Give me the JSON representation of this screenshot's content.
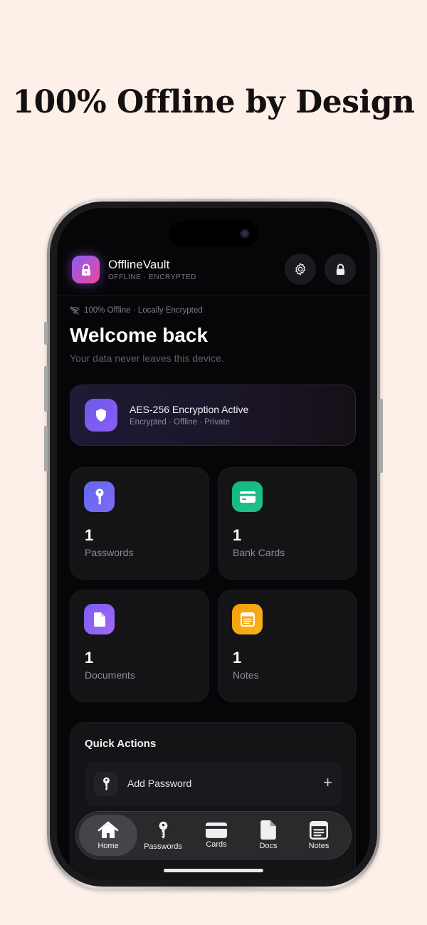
{
  "headline": "100% Offline by Design",
  "app": {
    "name": "OfflineVault",
    "subtitle": "OFFLINE · ENCRYPTED"
  },
  "status": {
    "text": "100% Offline · Locally Encrypted"
  },
  "welcome": {
    "title": "Welcome back",
    "subtitle": "Your data never leaves this device."
  },
  "encryption": {
    "title": "AES-256 Encryption Active",
    "subtitle": "Encrypted · Offline · Private"
  },
  "stats": [
    {
      "count": "1",
      "label": "Passwords",
      "icon": "key-icon",
      "color": "#6366f1"
    },
    {
      "count": "1",
      "label": "Bank Cards",
      "icon": "card-icon",
      "color": "#10b981"
    },
    {
      "count": "1",
      "label": "Documents",
      "icon": "document-icon",
      "color": "#8b5cf6"
    },
    {
      "count": "1",
      "label": "Notes",
      "icon": "note-icon",
      "color": "#f59e0b"
    }
  ],
  "quick_actions": {
    "title": "Quick Actions",
    "items": [
      {
        "label": "Add Password",
        "icon": "key-icon"
      }
    ]
  },
  "tabs": [
    {
      "label": "Home",
      "icon": "home-icon",
      "active": true
    },
    {
      "label": "Passwords",
      "icon": "key-icon"
    },
    {
      "label": "Cards",
      "icon": "card-icon"
    },
    {
      "label": "Docs",
      "icon": "document-icon"
    },
    {
      "label": "Notes",
      "icon": "note-icon"
    }
  ],
  "colors": {
    "background": "#fdf0e8",
    "screen": "#060608",
    "accent": "#8b5cf6"
  }
}
